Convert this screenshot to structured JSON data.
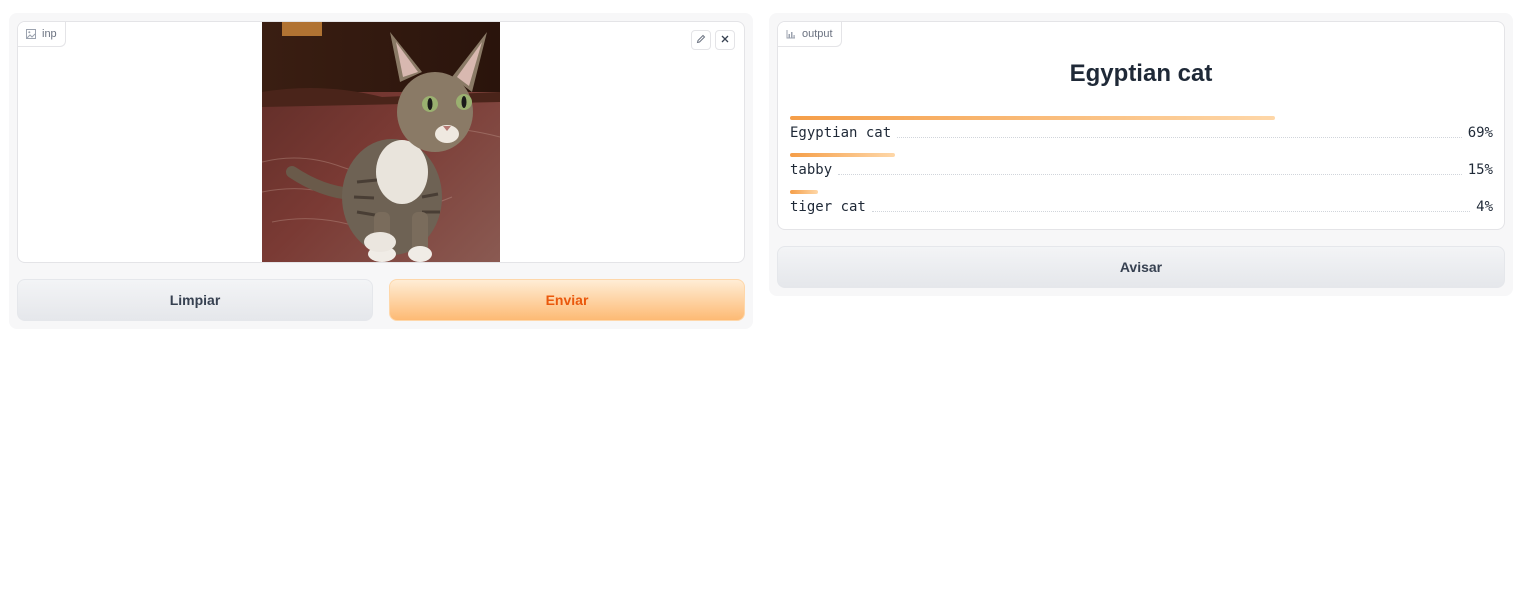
{
  "input_panel": {
    "label": "inp",
    "label_icon": "image-icon",
    "buttons": {
      "edit": "pencil-icon",
      "clear": "close-icon"
    }
  },
  "actions": {
    "clear_label": "Limpiar",
    "submit_label": "Enviar"
  },
  "output_panel": {
    "label": "output",
    "label_icon": "bar-chart-icon",
    "top_label": "Egyptian cat",
    "confidences": [
      {
        "label": "Egyptian cat",
        "percent": "69%",
        "value": 0.69
      },
      {
        "label": "tabby",
        "percent": "15%",
        "value": 0.15
      },
      {
        "label": "tiger cat",
        "percent": "4%",
        "value": 0.04
      }
    ]
  },
  "flag": {
    "label": "Avisar"
  },
  "colors": {
    "accent": "#f97316",
    "primary_text": "#ea580c"
  }
}
